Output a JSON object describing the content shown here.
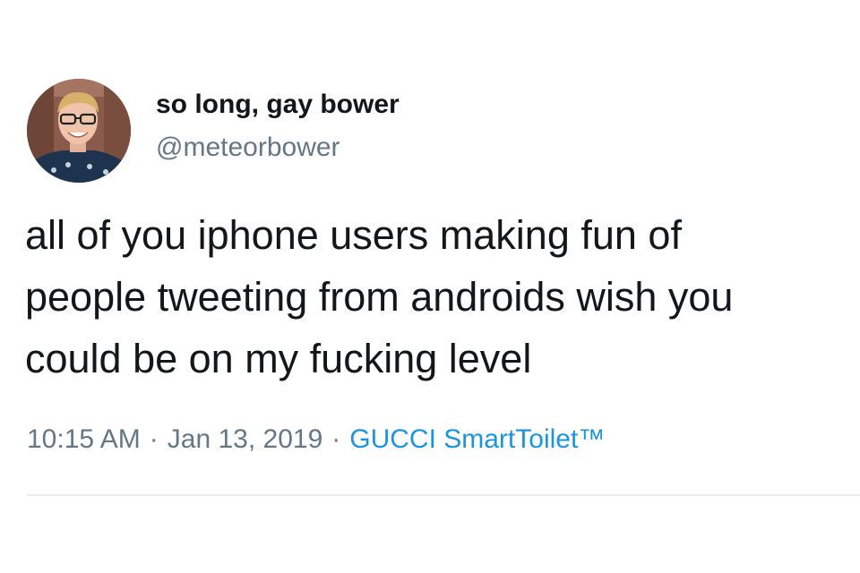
{
  "tweet": {
    "author": {
      "display_name": "so long, gay bower",
      "handle": "@meteorbower",
      "avatar_icon": "profile-photo"
    },
    "text_lines": [
      "all of you iphone users making fun of",
      "people tweeting from androids wish you",
      "could be on my fucking level"
    ],
    "time": "10:15 AM",
    "separator": "·",
    "date": "Jan 13, 2019",
    "source": "GUCCI SmartToilet™"
  },
  "colors": {
    "text": "#14171a",
    "secondary": "#657786",
    "link": "#1b95e0",
    "divider": "#e6ecf0"
  }
}
